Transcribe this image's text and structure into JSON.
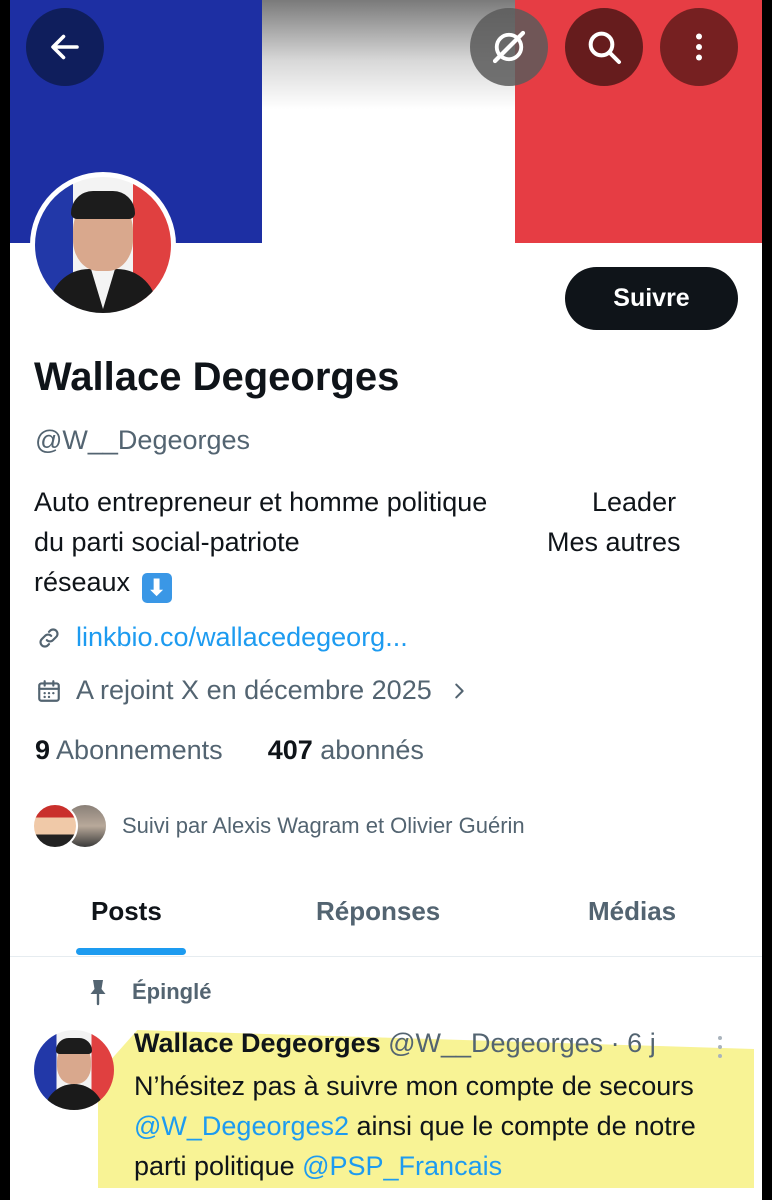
{
  "banner": {
    "flag_colors": {
      "blue": "#1d2fa3",
      "white": "#ffffff",
      "red": "#e63d44"
    },
    "icons": [
      "back-arrow-icon",
      "grok-icon",
      "search-icon",
      "more-vertical-icon"
    ]
  },
  "profile": {
    "follow_label": "Suivre",
    "name": "Wallace Degeorges",
    "handle": "@W__Degeorges",
    "bio": {
      "line1_left": "Auto entrepreneur et homme politique",
      "line1_right": "Leader",
      "line2_left": "du parti social-patriote",
      "line2_right": "Mes autres",
      "line3": "réseaux",
      "emoji": "⬇"
    },
    "link": "linkbio.co/wallacedegeorg...",
    "joined": "A rejoint X en décembre 2025",
    "following_count": "9",
    "following_label": "Abonnements",
    "followers_count": "407",
    "followers_label": "abonnés",
    "followed_by": "Suivi par Alexis Wagram et Olivier Guérin"
  },
  "tabs": [
    {
      "label": "Posts",
      "active": true
    },
    {
      "label": "Réponses",
      "active": false
    },
    {
      "label": "Médias",
      "active": false
    }
  ],
  "pinned_tweet": {
    "pinned_label": "Épinglé",
    "name": "Wallace Degeorges",
    "handle": "@W__Degeorges",
    "separator": "·",
    "time": "6 j",
    "text_part1": "N’hésitez pas à suivre mon compte de secours ",
    "mention1": "@W_Degeorges2",
    "text_part2": " ainsi que le compte de notre parti politique ",
    "mention2": "@PSP_Francais"
  },
  "colors": {
    "accent": "#1d9bf0",
    "text": "#0f1419",
    "muted": "#536471",
    "highlight": "#f7f28a"
  }
}
